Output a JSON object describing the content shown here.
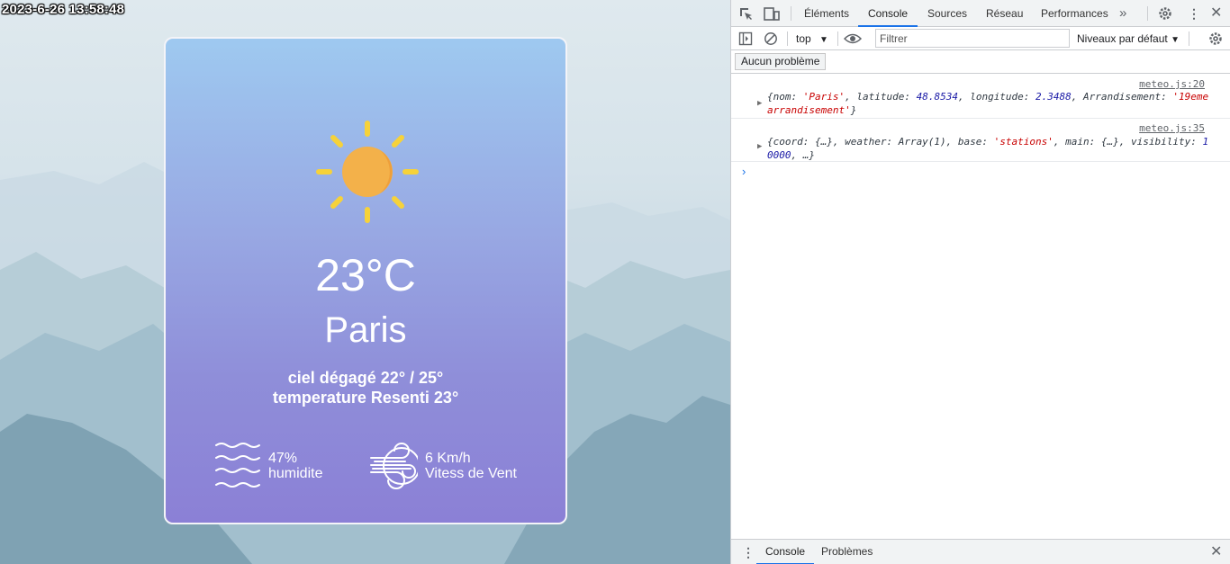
{
  "page": {
    "timestamp": "2023-6-26 13:58:48",
    "weather": {
      "temperature": "23°C",
      "city": "Paris",
      "description": "ciel dégagé 22° / 25°",
      "feels_like": "temperature Resenti 23°",
      "humidity_value": "47%",
      "humidity_label": "humidite",
      "wind_value": "6 Km/h",
      "wind_label": "Vitess de Vent",
      "icons": [
        "sun-icon",
        "waves-icon",
        "wind-icon"
      ]
    }
  },
  "devtools": {
    "tabs": [
      "Éléments",
      "Console",
      "Sources",
      "Réseau",
      "Performances"
    ],
    "active_tab": "Console",
    "context": "top",
    "filter_placeholder": "Filtrer",
    "levels": "Niveaux par défaut",
    "issues_button": "Aucun problème",
    "messages": [
      {
        "source": "meteo.js:20",
        "parts": [
          {
            "t": "{nom: ",
            "c": "k"
          },
          {
            "t": "'Paris'",
            "c": "s"
          },
          {
            "t": ", latitude: ",
            "c": "k"
          },
          {
            "t": "48.8534",
            "c": "n"
          },
          {
            "t": ", longitude: ",
            "c": "k"
          },
          {
            "t": "2.3488",
            "c": "n"
          },
          {
            "t": ", Arrandisement: ",
            "c": "k"
          },
          {
            "t": "'19eme arrandisement'",
            "c": "s"
          },
          {
            "t": "}",
            "c": "k"
          }
        ]
      },
      {
        "source": "meteo.js:35",
        "parts": [
          {
            "t": "{coord: {…}, weather: Array(1), base: ",
            "c": "k"
          },
          {
            "t": "'stations'",
            "c": "s"
          },
          {
            "t": ", main: {…}, visibility: ",
            "c": "k"
          },
          {
            "t": "10000",
            "c": "n"
          },
          {
            "t": ", …}",
            "c": "k"
          }
        ]
      }
    ],
    "drawer_tabs": [
      "Console",
      "Problèmes"
    ],
    "drawer_active": "Console",
    "accent_color": "#1a73e8"
  }
}
